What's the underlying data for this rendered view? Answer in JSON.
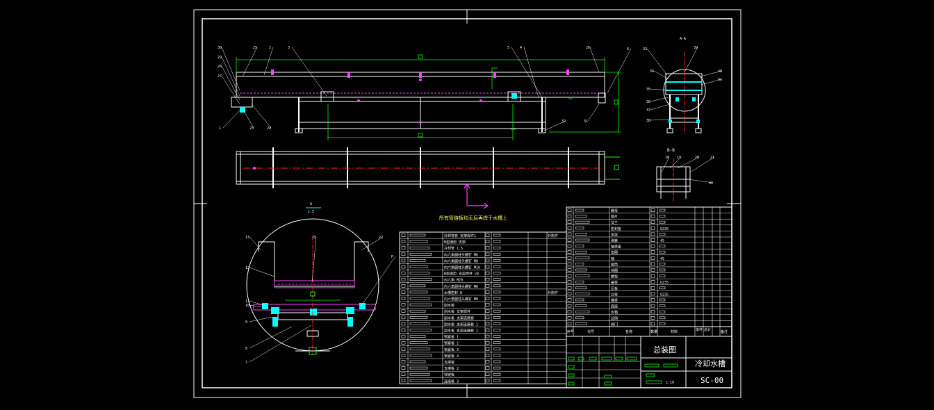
{
  "drawing": {
    "section_view_label": "A-A",
    "section_b_label": "B-B",
    "detail_scale": "1:5",
    "detail_letter": "A",
    "note": "所有管链板均无后再焊于水槽上"
  },
  "callouts_main": [
    "30",
    "29",
    "28",
    "27",
    "25",
    "2",
    "3",
    "1",
    "23",
    "24",
    "5",
    "4",
    "26",
    "6",
    "32",
    "31"
  ],
  "callouts_side": [
    "33",
    "34",
    "35",
    "36",
    "37",
    "38",
    "39",
    "40",
    "41"
  ],
  "callouts_b": [
    "18",
    "19",
    "20",
    "21",
    "42"
  ],
  "callouts_detail": [
    "13",
    "12",
    "11",
    "10",
    "9",
    "8",
    "7",
    "15",
    "22",
    "P"
  ],
  "title_block": {
    "title_left": "总装图",
    "title_right": "冷却水槽",
    "drawing_no": "SC-00",
    "scale": "1:10"
  },
  "bom_header": {
    "seq": "序号",
    "code": "代号",
    "name": "名称",
    "qty": "数量",
    "material": "材料",
    "weight_single": "单件",
    "weight_total": "总计",
    "remark": "备注"
  },
  "bom_left_names": [
    "冷却管管 支架焊件1",
    "B型通用 支架",
    "冷却管 1.5",
    "内六角圆柱头螺钉 M6",
    "内六角圆柱头螺钉 M8",
    "内六角圆柱头螺钉 M10",
    "B型通用 支架焊件 28",
    "内六角 M20",
    "内六角圆柱头螺钉 M6",
    "水槽密封 8",
    "内六角圆柱头螺钉 M8",
    "刮水板",
    "刮水板 支架焊件",
    "刮水板 支架连接板",
    "刮水板 支架连接板 1",
    "刮水板 支架连接板 2",
    "锁紧板 1",
    "锁紧板 2",
    "锁紧板 3",
    "锁紧板 4",
    "支撑板",
    "支撑板 2",
    "铰链板",
    "连接板 3"
  ],
  "bom_right_names": [
    "螺母",
    "垫片",
    "法兰",
    "密封垫",
    "支架",
    "弹簧",
    "轴承座",
    "垫圈",
    "轴",
    "套筒",
    "挡圈",
    "螺栓",
    "盖板",
    "压板",
    "立柱",
    "横梁",
    "底座",
    "水箱",
    "滤网",
    "阀门"
  ],
  "bom_right_materials": [
    "",
    "",
    "",
    "Q235",
    "",
    "45",
    "",
    "",
    "45",
    "",
    "",
    "",
    "Q235",
    "",
    "Q235",
    "",
    "",
    "",
    "",
    ""
  ],
  "bom_left_remarks": [
    "外购件",
    "",
    "",
    "",
    "",
    "",
    "",
    "",
    "",
    "外购件",
    "",
    "",
    "",
    "",
    "",
    "",
    "",
    "",
    "",
    "",
    "",
    "",
    "",
    ""
  ]
}
